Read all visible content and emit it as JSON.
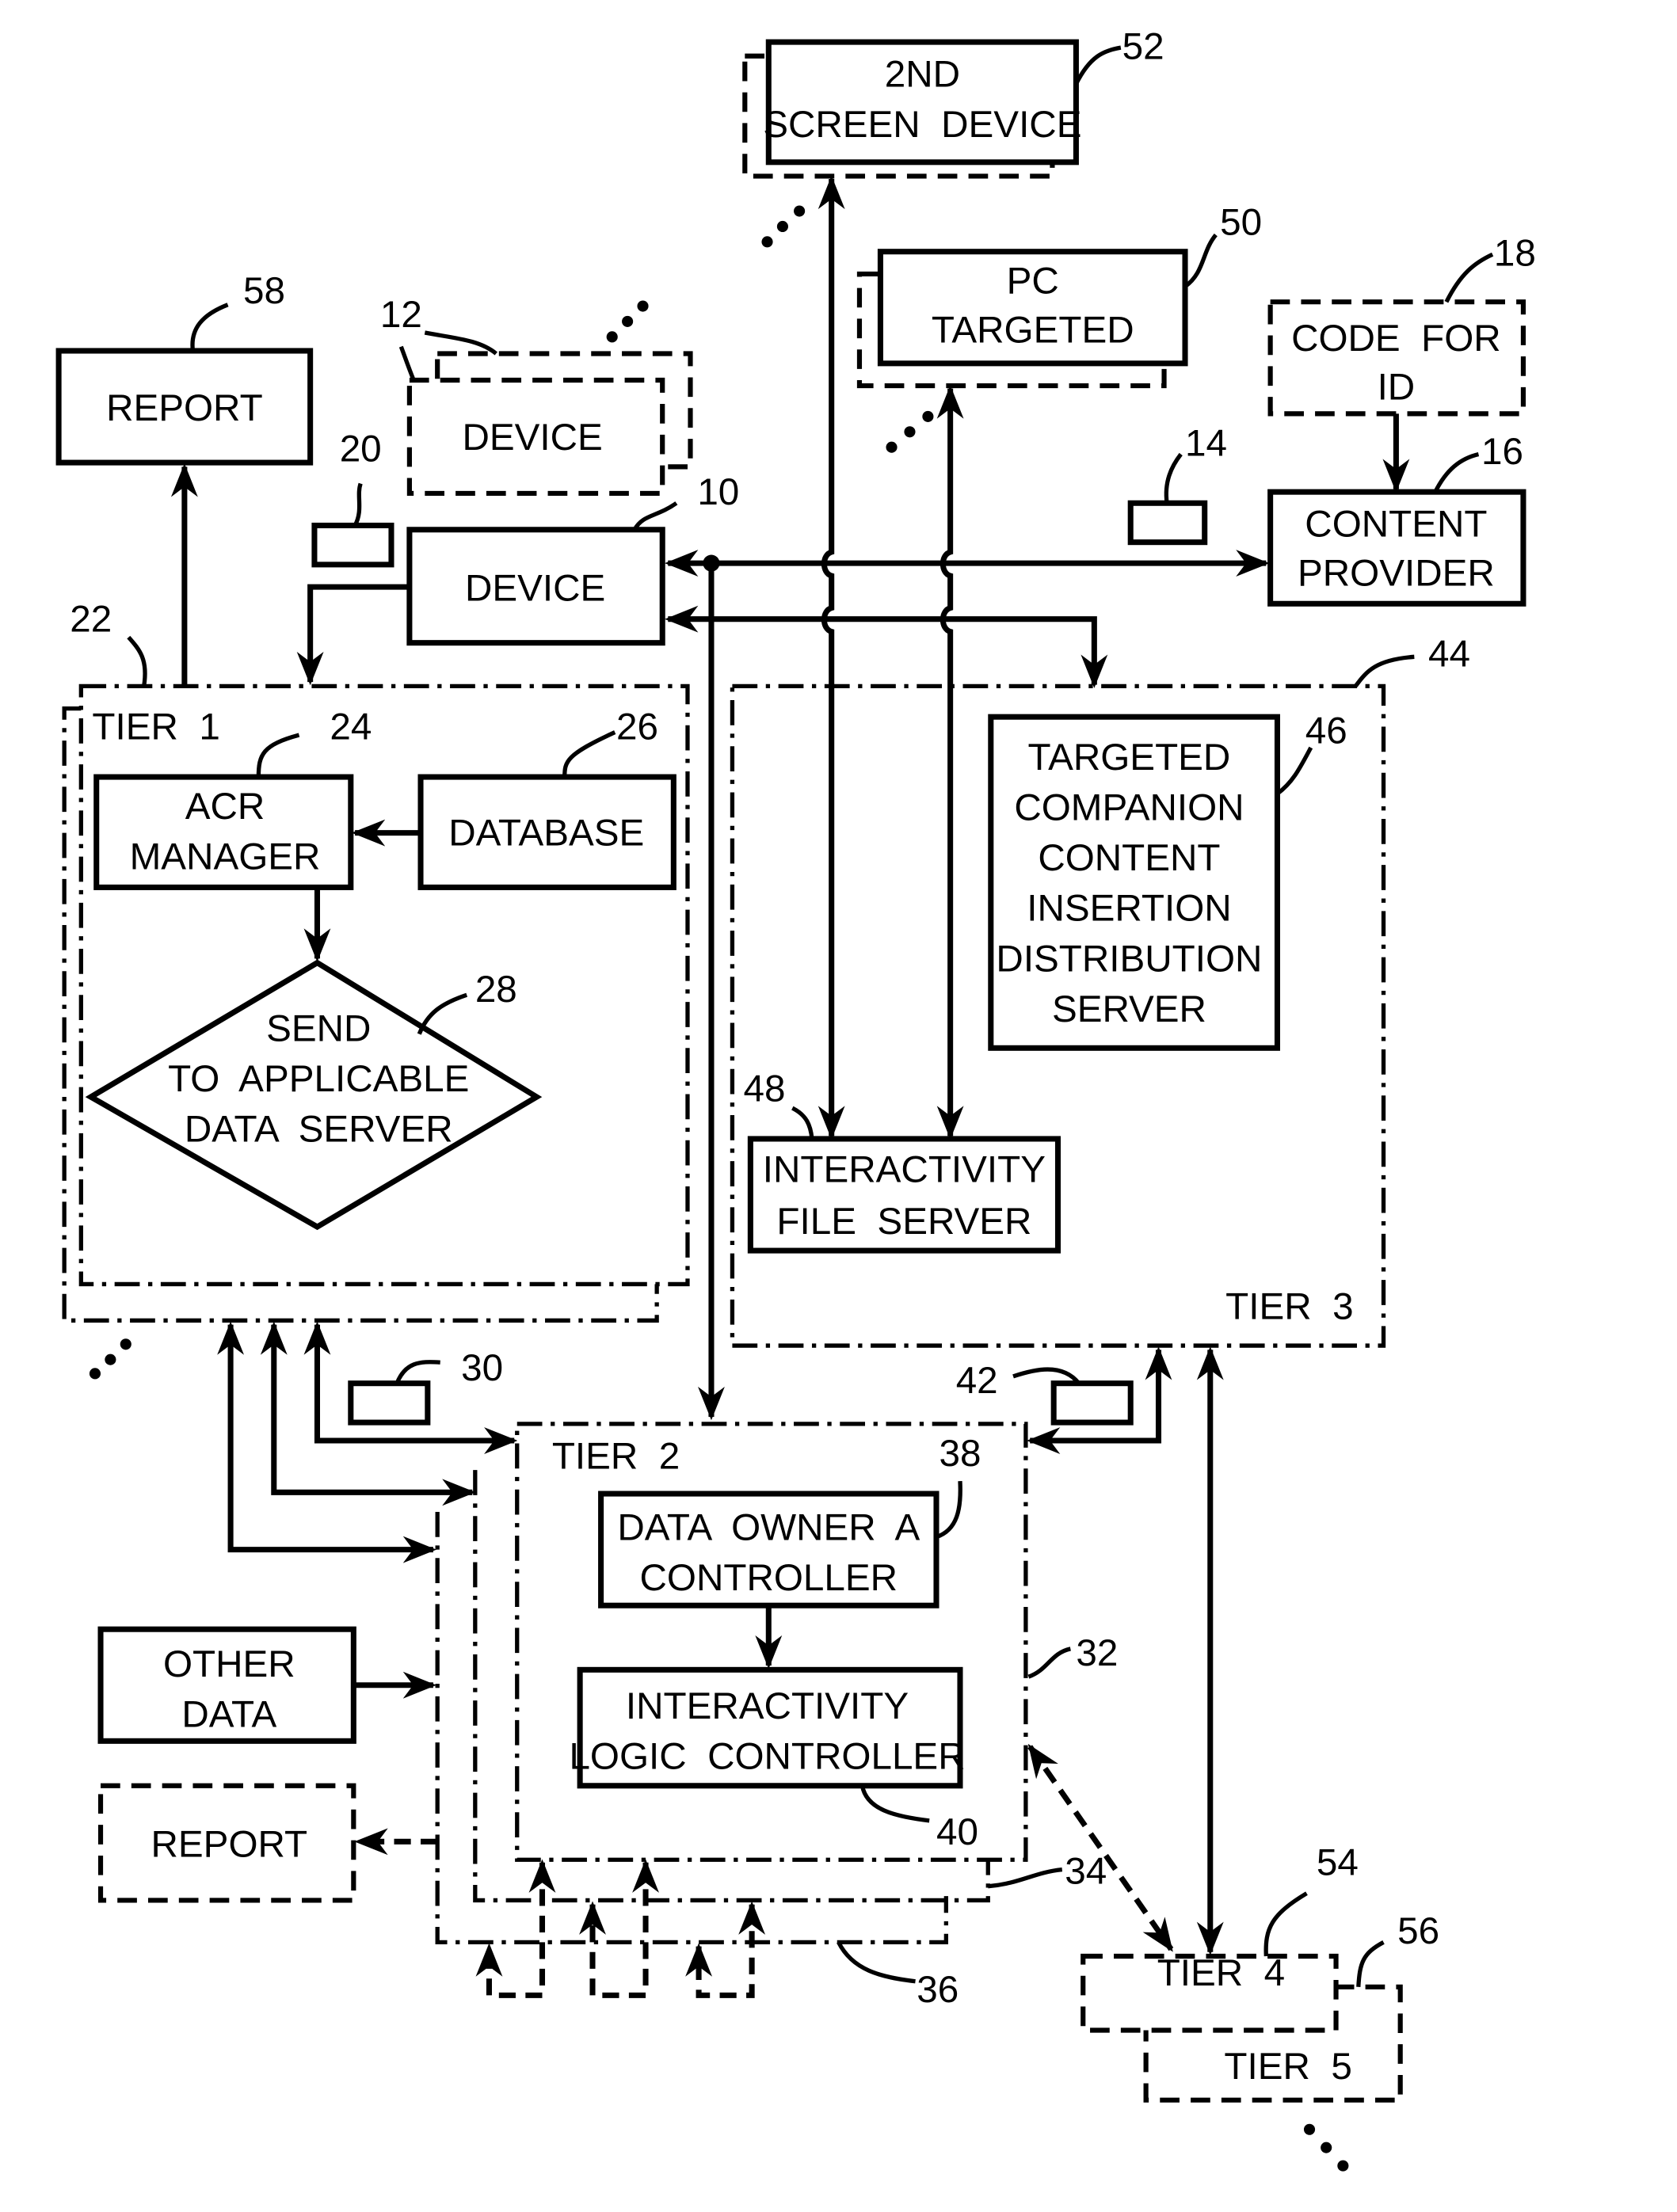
{
  "figure": {
    "nodes": {
      "second_screen": {
        "lines": [
          "2ND",
          "SCREEN  DEVICE"
        ],
        "ref": "52"
      },
      "pc_targeted": {
        "lines": [
          "PC",
          "TARGETED"
        ],
        "ref": "50"
      },
      "code_for_id": {
        "lines": [
          "CODE  FOR",
          "ID"
        ],
        "ref": "18"
      },
      "content_provider": {
        "lines": [
          "CONTENT",
          "PROVIDER"
        ],
        "ref": "16"
      },
      "report_top": {
        "lines": [
          "REPORT"
        ],
        "ref": "58"
      },
      "device_multi": {
        "lines": [
          "DEVICE"
        ],
        "ref": "12"
      },
      "device": {
        "lines": [
          "DEVICE"
        ],
        "ref": "10"
      },
      "packet_20": {
        "ref": "20"
      },
      "packet_14": {
        "ref": "14"
      },
      "tier1": {
        "title": "TIER  1",
        "ref": "22"
      },
      "acr_manager": {
        "lines": [
          "ACR",
          "MANAGER"
        ],
        "ref": "24"
      },
      "database": {
        "lines": [
          "DATABASE"
        ],
        "ref": "26"
      },
      "send_decision": {
        "lines": [
          "SEND",
          "TO  APPLICABLE",
          "DATA  SERVER"
        ],
        "ref": "28"
      },
      "tier3": {
        "title": "TIER  3",
        "ref": "44"
      },
      "targeted_companion": {
        "lines": [
          "TARGETED",
          "COMPANION",
          "CONTENT",
          "INSERTION",
          "DISTRIBUTION",
          "SERVER"
        ],
        "ref": "46"
      },
      "interactivity_file_server": {
        "lines": [
          "INTERACTIVITY",
          "FILE  SERVER"
        ],
        "ref": "48"
      },
      "packet_30": {
        "ref": "30"
      },
      "packet_42": {
        "ref": "42"
      },
      "tier2": {
        "title": "TIER  2",
        "ref": "32"
      },
      "tier2_stack_34": {
        "ref": "34"
      },
      "tier2_stack_36": {
        "ref": "36"
      },
      "data_owner_controller": {
        "lines": [
          "DATA  OWNER  A",
          "CONTROLLER"
        ],
        "ref": "38"
      },
      "interactivity_logic_controller": {
        "lines": [
          "INTERACTIVITY",
          "LOGIC  CONTROLLER"
        ],
        "ref": "40"
      },
      "other_data": {
        "lines": [
          "OTHER",
          "DATA"
        ]
      },
      "report_bottom": {
        "lines": [
          "REPORT"
        ]
      },
      "tier4": {
        "title": "TIER  4",
        "ref": "54"
      },
      "tier5": {
        "title": "TIER  5",
        "ref": "56"
      }
    }
  }
}
